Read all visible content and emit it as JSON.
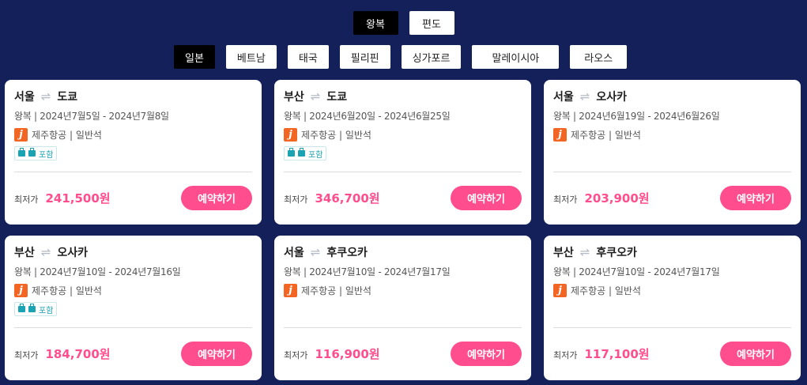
{
  "trip_types": [
    {
      "label": "왕복",
      "active": true
    },
    {
      "label": "편도",
      "active": false
    }
  ],
  "countries": [
    {
      "label": "일본",
      "active": true
    },
    {
      "label": "베트남",
      "active": false
    },
    {
      "label": "태국",
      "active": false
    },
    {
      "label": "필리핀",
      "active": false
    },
    {
      "label": "싱가포르",
      "active": false
    },
    {
      "label": "말레이시아",
      "active": false
    },
    {
      "label": "라오스",
      "active": false
    }
  ],
  "cards": [
    {
      "origin": "서울",
      "destination": "도쿄",
      "dates": "왕복 | 2024년7월5일 - 2024년7월8일",
      "airline": "제주항공 | 일반석",
      "baggage": "포함",
      "price_label": "최저가",
      "price": "241,500원",
      "button": "예약하기"
    },
    {
      "origin": "부산",
      "destination": "도쿄",
      "dates": "왕복 | 2024년6월20일 - 2024년6월25일",
      "airline": "제주항공 | 일반석",
      "baggage": "포함",
      "price_label": "최저가",
      "price": "346,700원",
      "button": "예약하기"
    },
    {
      "origin": "서울",
      "destination": "오사카",
      "dates": "왕복 | 2024년6월19일 - 2024년6월26일",
      "airline": "제주항공 | 일반석",
      "baggage": null,
      "price_label": "최저가",
      "price": "203,900원",
      "button": "예약하기"
    },
    {
      "origin": "부산",
      "destination": "오사카",
      "dates": "왕복 | 2024년7월10일 - 2024년7월16일",
      "airline": "제주항공 | 일반석",
      "baggage": "포함",
      "price_label": "최저가",
      "price": "184,700원",
      "button": "예약하기"
    },
    {
      "origin": "서울",
      "destination": "후쿠오카",
      "dates": "왕복 | 2024년7월10일 - 2024년7월17일",
      "airline": "제주항공 | 일반석",
      "baggage": null,
      "price_label": "최저가",
      "price": "116,900원",
      "button": "예약하기"
    },
    {
      "origin": "부산",
      "destination": "후쿠오카",
      "dates": "왕복 | 2024년7월10일 - 2024년7월17일",
      "airline": "제주항공 | 일반석",
      "baggage": null,
      "price_label": "최저가",
      "price": "117,100원",
      "button": "예약하기"
    }
  ],
  "icons": {
    "swap": "swap-arrows-icon",
    "airline_logo": "jeju-air-logo-icon",
    "baggage": "luggage-icon"
  },
  "colors": {
    "background": "#14205a",
    "accent": "#ff4d8d",
    "baggage": "#1aa3b3",
    "airline_logo": "#f26522"
  }
}
